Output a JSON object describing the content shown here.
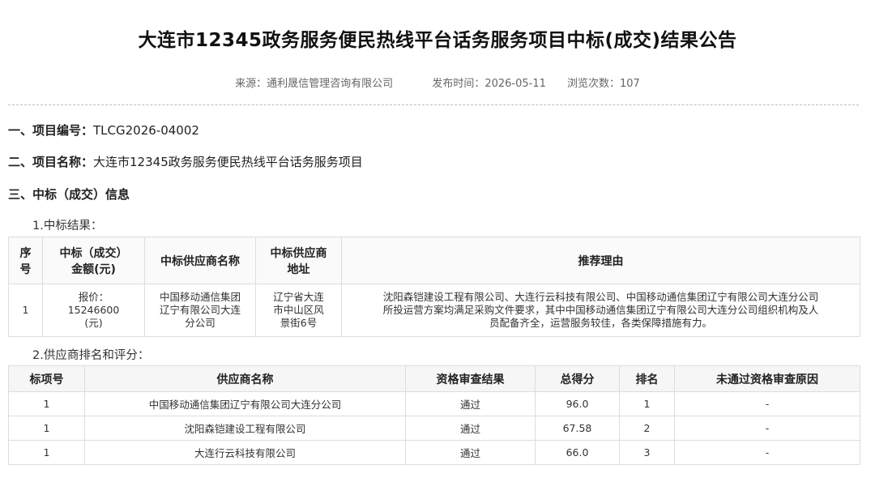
{
  "title": "大连市12345政务服务便民热线平台话务服务项目中标(成交)结果公告",
  "meta": {
    "source": "来源：通利晟信管理咨询有限公司",
    "publish": "发布时间：2026-05-11",
    "views": "浏览次数：107"
  },
  "sections": {
    "s1_label": "一、项目编号：",
    "s1_value": "TLCG2026-04002",
    "s2_label": "二、项目名称：",
    "s2_value": "大连市12345政务服务便民热线平台话务服务项目",
    "s3_label": "三、中标（成交）信息",
    "sub1": "1.中标结果：",
    "sub2": "2.供应商排名和评分："
  },
  "table1": {
    "headers": [
      "序号",
      "中标（成交）金额(元)",
      "中标供应商名称",
      "中标供应商地址",
      "推荐理由"
    ],
    "header_lines": {
      "h0a": "序",
      "h0b": "号",
      "h1a": "中标（成交）",
      "h1b": "金额(元)",
      "h3a": "中标供应商",
      "h3b": "地址"
    },
    "row": {
      "index": "1",
      "amount_a": "报价：",
      "amount_b": "15246600",
      "amount_c": "(元)",
      "name_a": "中国移动通信集团",
      "name_b": "辽宁有限公司大连",
      "name_c": "分公司",
      "addr_a": "辽宁省大连",
      "addr_b": "市中山区风",
      "addr_c": "景街6号",
      "reason_a": "沈阳森铠建设工程有限公司、大连行云科技有限公司、中国移动通信集团辽宁有限公司大连分公司",
      "reason_b": "所投运营方案均满足采购文件要求，其中中国移动通信集团辽宁有限公司大连分公司组织机构及人",
      "reason_c": "员配备齐全，运营服务较佳，各类保障措施有力。"
    }
  },
  "table2": {
    "headers": [
      "标项号",
      "供应商名称",
      "资格审查结果",
      "总得分",
      "排名",
      "未通过资格审查原因"
    ],
    "rows": [
      [
        "1",
        "中国移动通信集团辽宁有限公司大连分公司",
        "通过",
        "96.0",
        "1",
        "-"
      ],
      [
        "1",
        "沈阳森铠建设工程有限公司",
        "通过",
        "67.58",
        "2",
        "-"
      ],
      [
        "1",
        "大连行云科技有限公司",
        "通过",
        "66.0",
        "3",
        "-"
      ]
    ]
  }
}
